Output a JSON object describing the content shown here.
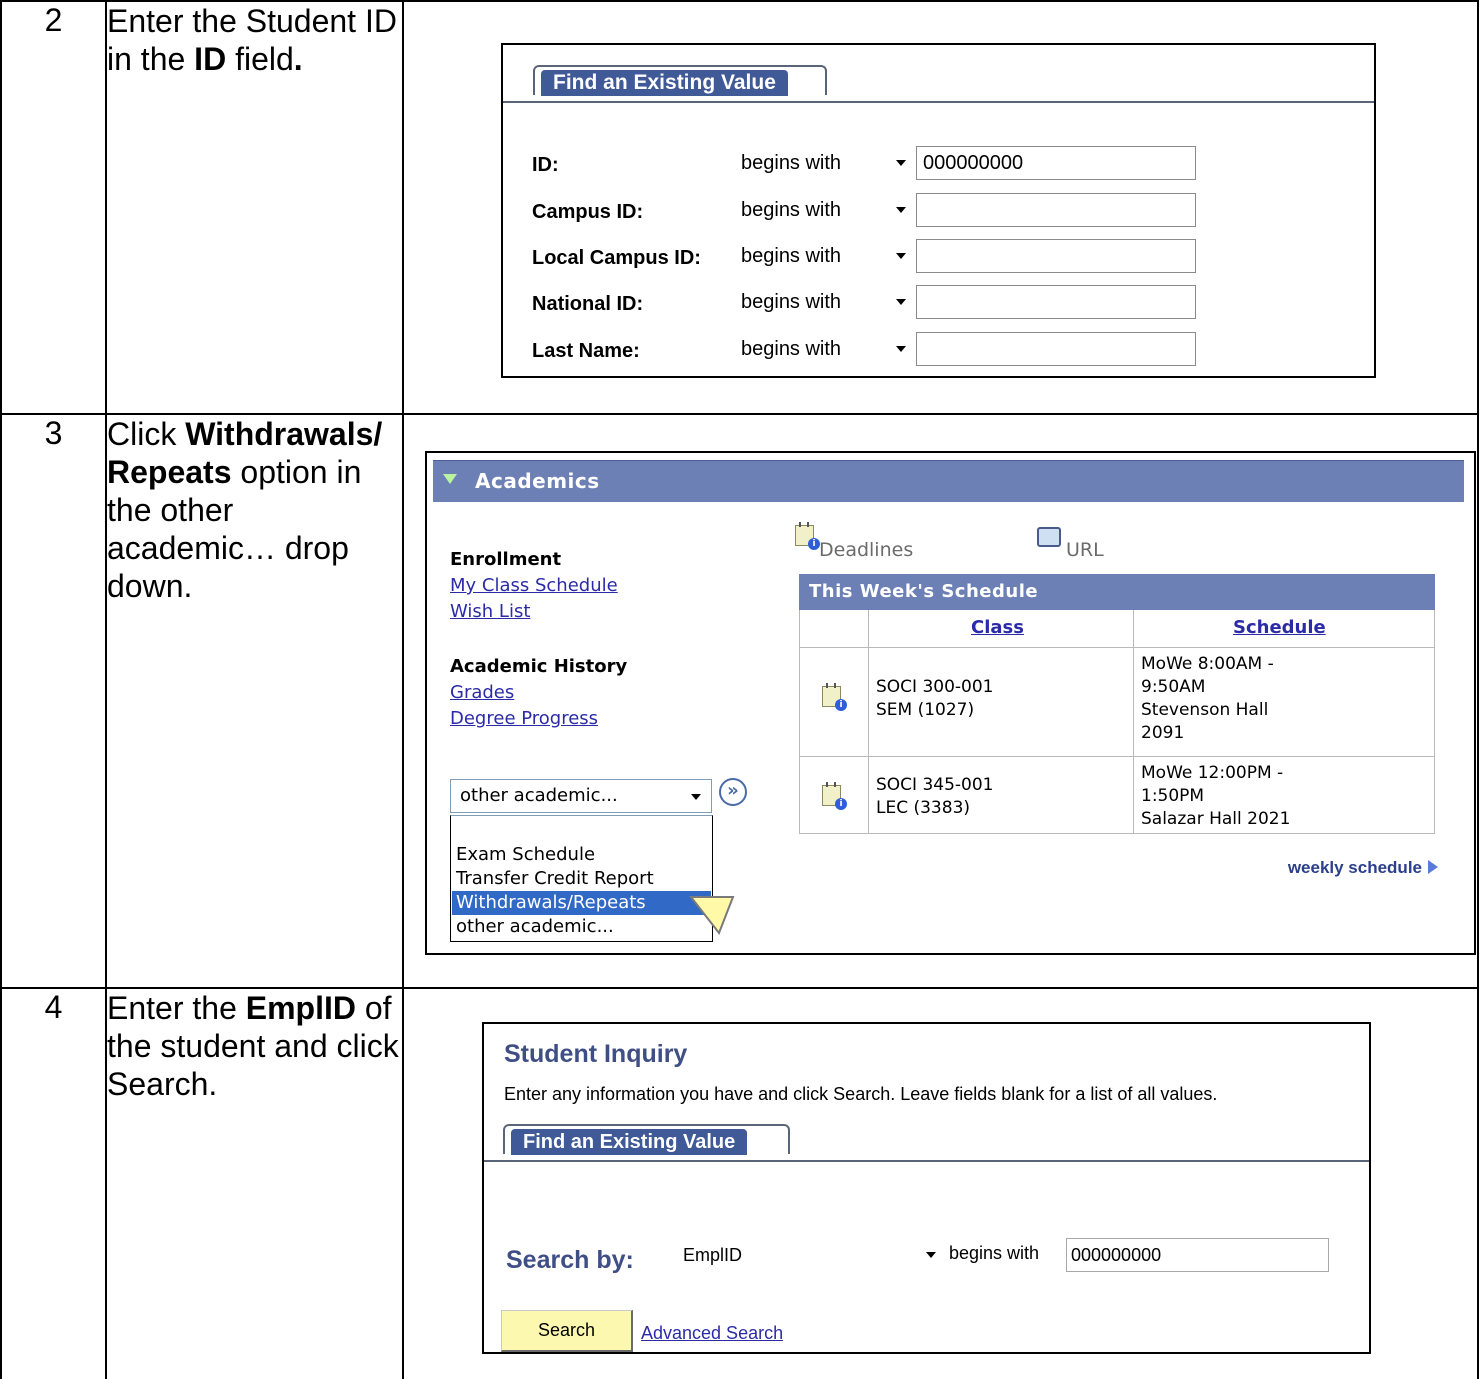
{
  "steps": [
    {
      "num": "2",
      "text_parts": [
        "Enter the Student ID in the ",
        "ID",
        " field",
        "."
      ]
    },
    {
      "num": "3",
      "text_parts": [
        "Click ",
        "Withdrawals/ Repeats",
        " option in the other academic… drop down."
      ]
    },
    {
      "num": "4",
      "text_parts": [
        "Enter the ",
        "EmplID",
        " of the student and click Search."
      ]
    }
  ],
  "find_value": {
    "tab_label": "Find an Existing Value",
    "fields": [
      {
        "label": "ID:",
        "operator": "begins with",
        "value": "000000000"
      },
      {
        "label": "Campus ID:",
        "operator": "begins with",
        "value": ""
      },
      {
        "label": "Local Campus ID:",
        "operator": "begins with",
        "value": ""
      },
      {
        "label": "National ID:",
        "operator": "begins with",
        "value": ""
      },
      {
        "label": "Last Name:",
        "operator": "begins with",
        "value": ""
      }
    ]
  },
  "academics": {
    "title": "Academics",
    "enrollment_heading": "Enrollment",
    "enrollment_links": [
      "My Class Schedule",
      "Wish List"
    ],
    "history_heading": "Academic History",
    "history_links": [
      "Grades",
      "Degree Progress"
    ],
    "deadlines_label": "Deadlines",
    "url_label": "URL",
    "schedule": {
      "title": "This Week's Schedule",
      "col_class": "Class",
      "col_schedule": "Schedule",
      "rows": [
        {
          "class_lines": [
            "SOCI 300-001",
            "SEM (1027)"
          ],
          "schedule_lines": [
            "MoWe 8:00AM -",
            "9:50AM",
            "Stevenson Hall",
            "2091"
          ]
        },
        {
          "class_lines": [
            "SOCI 345-001",
            "LEC (3383)"
          ],
          "schedule_lines": [
            "MoWe 12:00PM -",
            "1:50PM",
            "Salazar Hall 2021"
          ]
        }
      ]
    },
    "weekly_link": "weekly schedule",
    "dropdown": {
      "selected": "other academic...",
      "go_symbol": "»",
      "options": [
        "Exam Schedule",
        "Transfer Credit Report",
        "Withdrawals/Repeats",
        "other academic..."
      ],
      "highlighted_option": "Withdrawals/Repeats"
    }
  },
  "student_inquiry": {
    "title": "Student Inquiry",
    "description": "Enter any information you have and click Search. Leave fields blank for a list of all values.",
    "tab_label": "Find an Existing Value",
    "search_by_label": "Search by:",
    "search_by_value": "EmplID",
    "operator": "begins with",
    "value": "000000000",
    "search_button": "Search",
    "advanced_link": "Advanced Search"
  },
  "colors": {
    "tab_blue": "#3f5a96",
    "header_blue": "#6d80b5",
    "link_blue": "#2b2ba8",
    "highlight": "#3169c6",
    "search_button": "#fcf8b0"
  }
}
